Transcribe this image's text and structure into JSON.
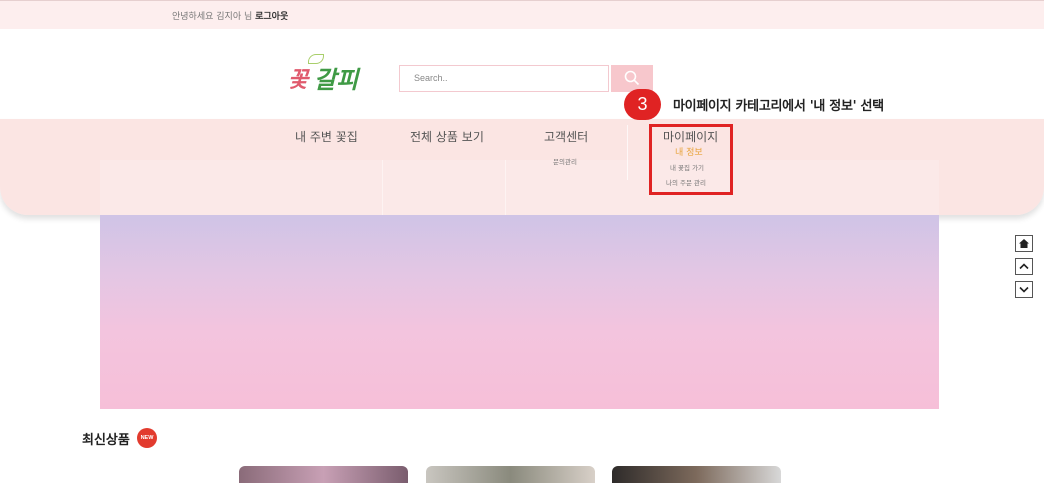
{
  "topbar": {
    "greeting": "안녕하세요 김지아 님",
    "logout": "로그아웃"
  },
  "logo": {
    "part1": "꽃",
    "part2": "갈피"
  },
  "search": {
    "placeholder": "Search.."
  },
  "nav": {
    "items": [
      {
        "label": "내 주변 꽃집"
      },
      {
        "label": "전체 상품 보기"
      },
      {
        "label": "고객센터",
        "sub": [
          "문의관리"
        ]
      },
      {
        "label": "마이페이지",
        "sub": [
          "내 정보",
          "내 꽃집 가기",
          "나의 주문 관리"
        ]
      }
    ]
  },
  "annotation": {
    "step": "3",
    "text": "마이페이지 카테고리에서 '내 정보' 선택"
  },
  "section": {
    "title": "최신상품",
    "badge": "NEW"
  },
  "side_buttons": [
    "home-icon",
    "chevron-up-icon",
    "chevron-down-icon"
  ],
  "colors": {
    "accent": "#e02323",
    "active_sub": "#e8a33a",
    "nav_bg": "#f8d4d0",
    "topbar_bg": "#fdeeee"
  }
}
